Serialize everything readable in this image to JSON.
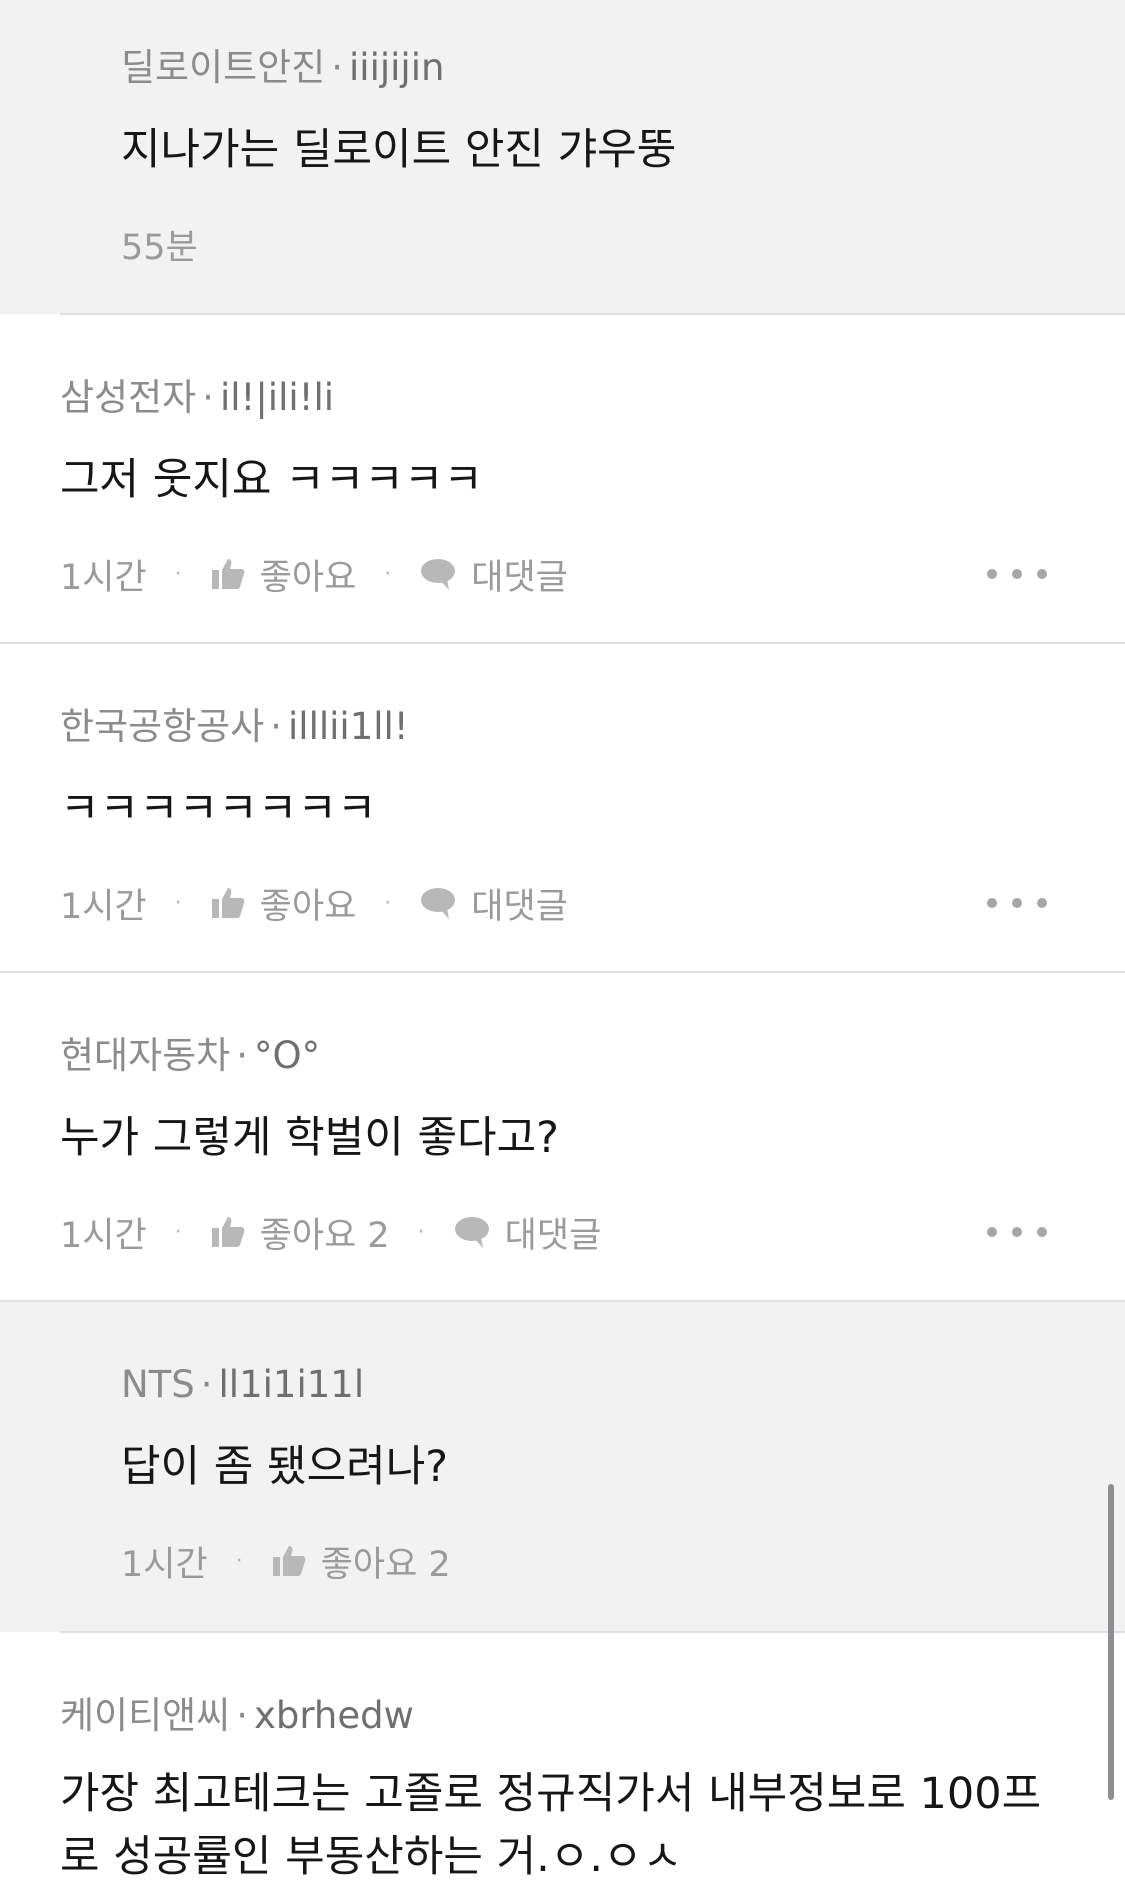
{
  "comments": [
    {
      "company": "딜로이트안진",
      "nickname": "iiijijin",
      "text": "지나가는 딜로이트 안진 갸우뚱",
      "time": "55분"
    },
    {
      "company": "삼성전자",
      "nickname": "il!|ili!li",
      "text": "그저 웃지요 ㅋㅋㅋㅋㅋ",
      "time": "1시간",
      "like_label": "좋아요",
      "reply_label": "대댓글"
    },
    {
      "company": "한국공항공사",
      "nickname": "illlii1ll!",
      "text": "ㅋㅋㅋㅋㅋㅋㅋㅋ",
      "time": "1시간",
      "like_label": "좋아요",
      "reply_label": "대댓글"
    },
    {
      "company": "현대자동차",
      "nickname": "°O°",
      "text": "누가 그렇게 학벌이 좋다고?",
      "time": "1시간",
      "like_label": "좋아요 2",
      "reply_label": "대댓글"
    },
    {
      "company": "NTS",
      "nickname": "ll1i1i11l",
      "text": "답이 좀 됐으려나?",
      "time": "1시간",
      "like_label": "좋아요 2"
    },
    {
      "company": "케이티앤씨",
      "nickname": "xbrhedw",
      "text": "가장 최고테크는 고졸로 정규직가서 내부정보로 100프로 성공률인 부동산하는 거.ㅇ.ㅇㅅ"
    }
  ],
  "separator_dot": "·",
  "icons": {
    "like": "thumbs-up-icon",
    "reply": "speech-bubble-icon",
    "more": "more-horizontal-icon"
  }
}
